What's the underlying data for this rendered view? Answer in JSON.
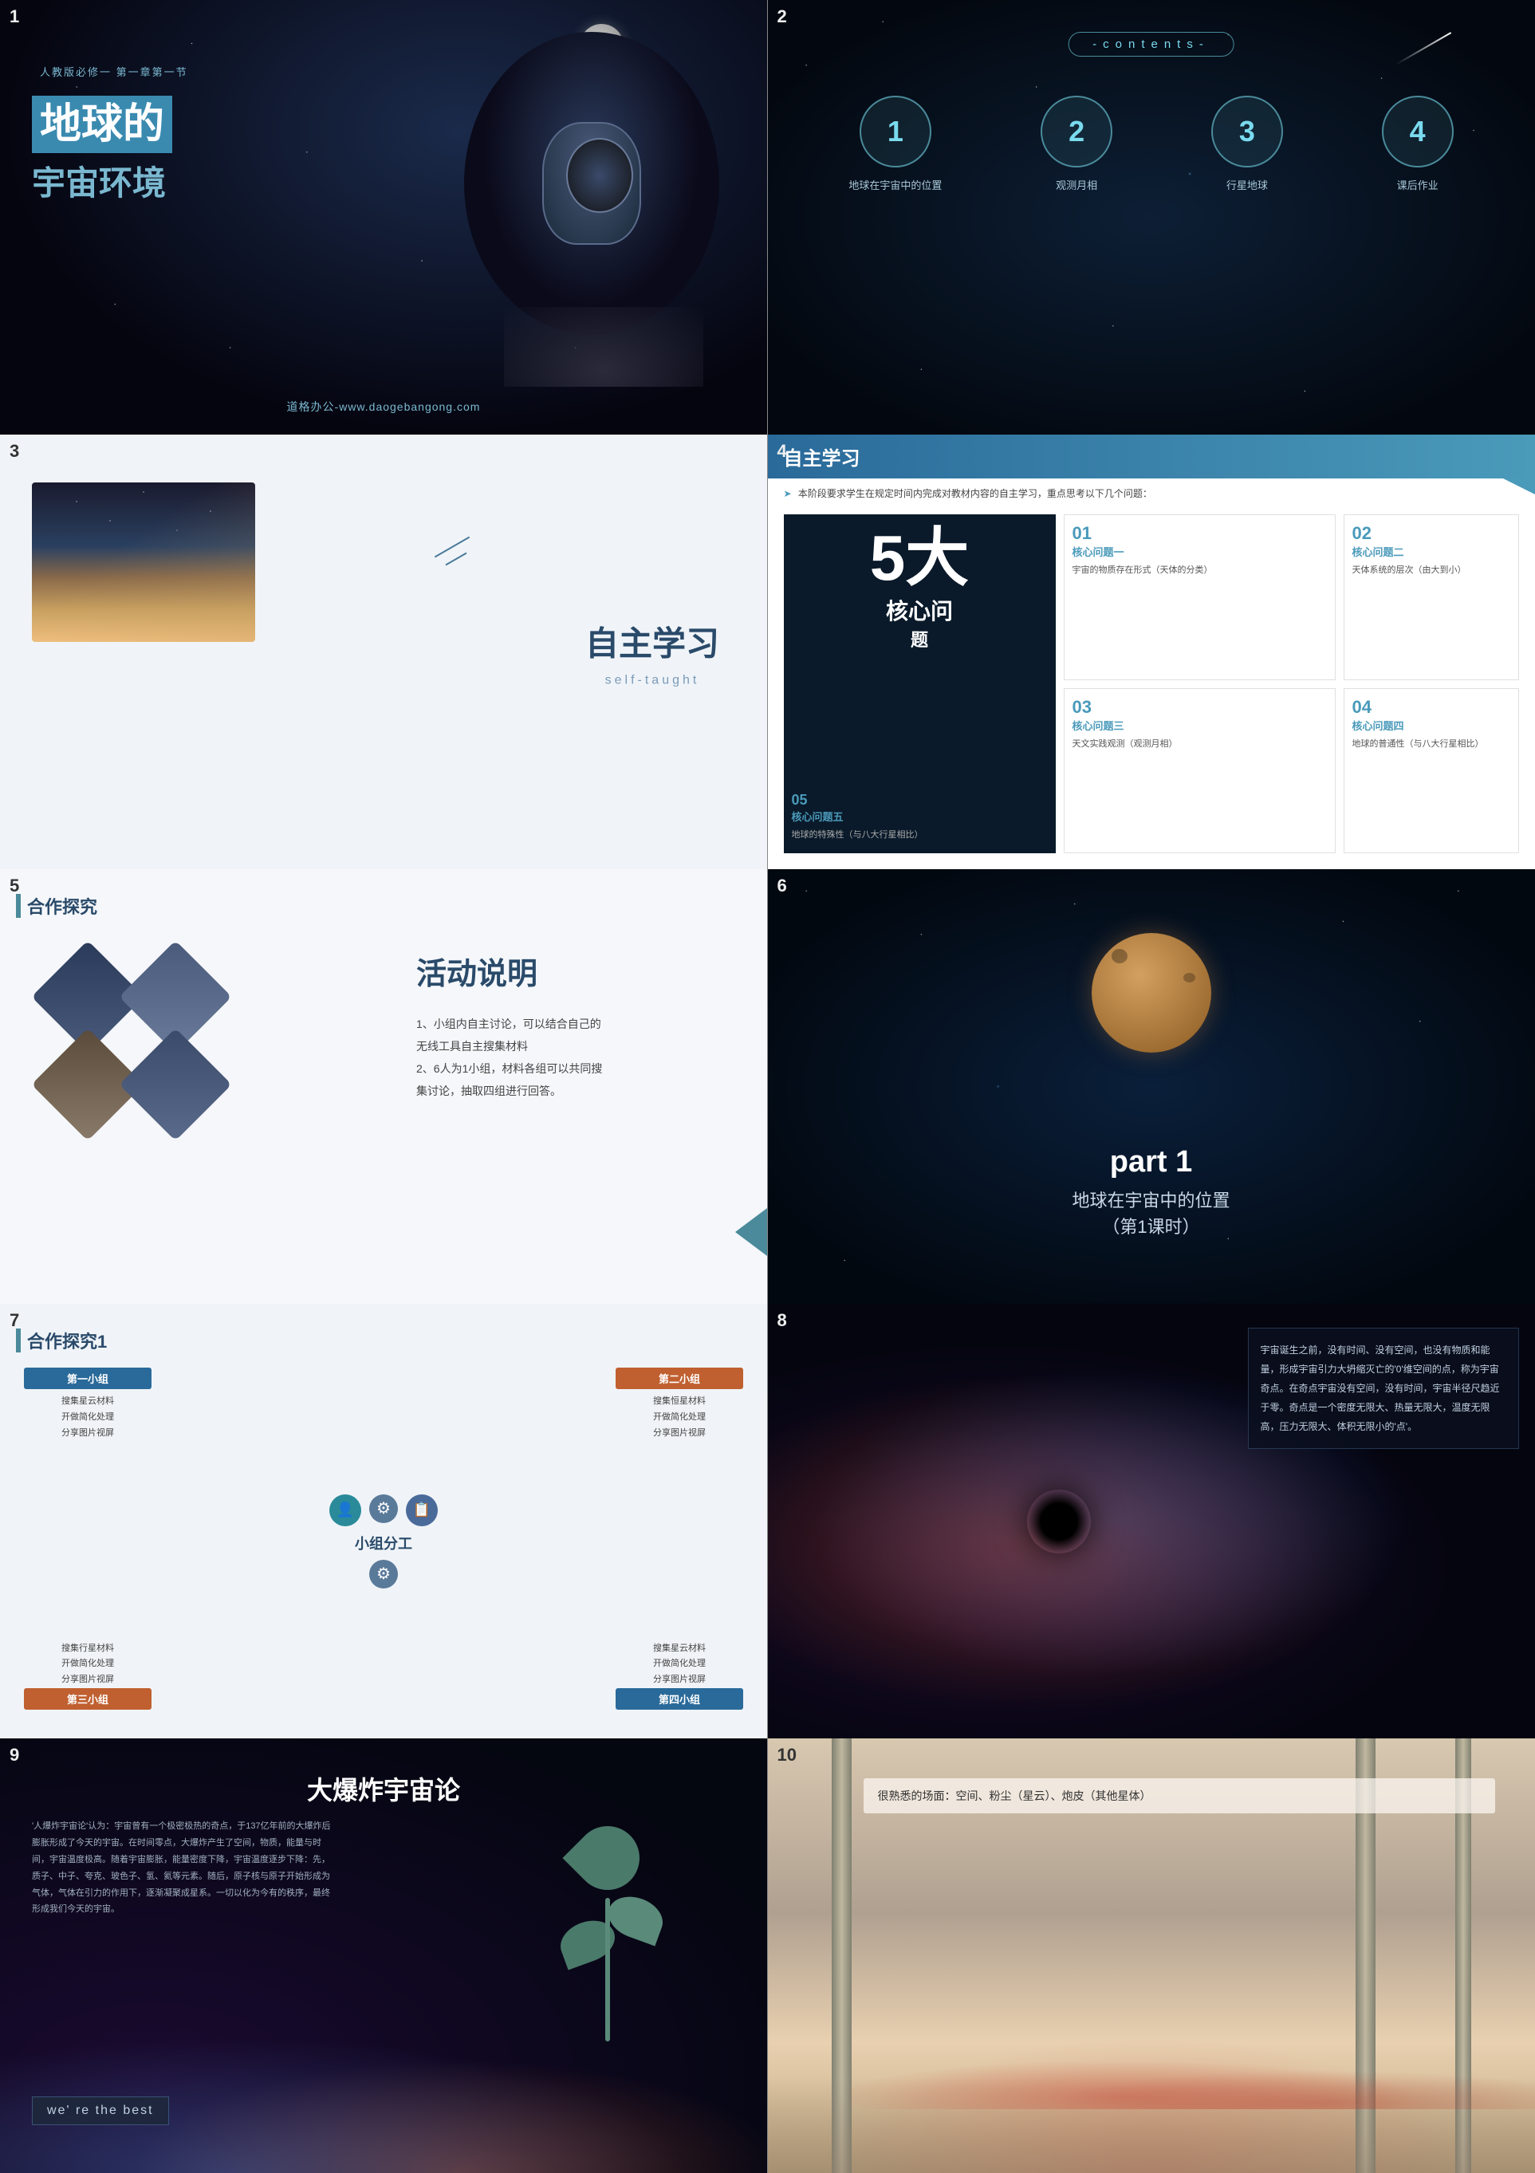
{
  "slide1": {
    "number": "1",
    "subtitle": "人教版必修一 第一章第一节",
    "title_main": "地球的",
    "title_sub": "宇宙环境",
    "footer": "道格办公-www.daogebangong.com"
  },
  "slide2": {
    "number": "2",
    "contents_label": "-contents-",
    "circles": [
      {
        "number": "1",
        "label": "地球在宇宙中的位置"
      },
      {
        "number": "2",
        "label": "观测月相"
      },
      {
        "number": "3",
        "label": "行星地球"
      },
      {
        "number": "4",
        "label": "课后作业"
      }
    ]
  },
  "slide3": {
    "number": "3",
    "main_title": "自主学习",
    "sub_title": "self-taught"
  },
  "slide4": {
    "number": "4",
    "header_title": "自主学习",
    "intro": "本阶段要求学生在规定时间内完成对教材内容的自主学习，重点思考以下几个问题：",
    "items": [
      {
        "num": "01",
        "title": "核心问题一",
        "text": "宇宙的物质存在形式（天体的分类）"
      },
      {
        "num": "02",
        "title": "核心问题二",
        "text": "天体系统的层次（由大到小）"
      },
      {
        "num": "03",
        "title": "核心问题三",
        "text": "天文实践观测（观测月相）"
      },
      {
        "num": "04",
        "title": "核心问题四",
        "text": "地球的普通性（与八大行星相比）"
      }
    ],
    "special_num": "5大",
    "special_text": "核心问",
    "special_sub": "题",
    "special_item_num": "05",
    "special_item_title": "核心问题五",
    "special_item_text": "地球的特殊性（与八大行星相比）"
  },
  "slide5": {
    "number": "5",
    "header_title": "合作探究",
    "activity_title": "活动说明",
    "activity_text1": "1、小组内自主讨论，可以结合自己的\n无线工具自主搜集材料",
    "activity_text2": "2、6人为1小组，材料各组可以共同搜\n集讨论，抽取四组进行回答。"
  },
  "slide6": {
    "number": "6",
    "part": "part 1",
    "subtitle1": "地球在宇宙中的位置",
    "subtitle2": "（第1课时）"
  },
  "slide7": {
    "number": "7",
    "header_title": "合作探究1",
    "center_title": "小组分工",
    "groups": [
      {
        "title": "第一小组",
        "color": "blue",
        "tasks": [
          "搜集星云材料",
          "开做简化处理",
          "分享图片视屏"
        ]
      },
      {
        "title": "第二小组",
        "color": "orange",
        "tasks": [
          "搜集恒星材料",
          "开做简化处理",
          "分享图片视屏"
        ]
      },
      {
        "title": "第三小组",
        "color": "orange",
        "tasks": [
          "搜集行星材料",
          "开做简化处理",
          "分享图片视屏"
        ]
      },
      {
        "title": "第四小组",
        "color": "blue",
        "tasks": [
          "搜集星云材料",
          "开做简化处理",
          "分享图片视屏"
        ]
      }
    ]
  },
  "slide8": {
    "number": "8",
    "text": "宇宙诞生之前，没有时间、没有空间，也没有物质和能量，形成宇宙引力大坍缩灭亡的'0'维空间的点，称为宇宙奇点。在奇点宇宙没有空间，没有时间，宇宙半径尺趋近于零。奇点是一个密度无限大、热量无限大，温度无限高，压力无限大、体积无限小的'点'。"
  },
  "slide9": {
    "number": "9",
    "title": "大爆炸宇宙论",
    "text": "'人爆炸宇宙论'认为：宇宙曾有一个极密极热的奇点，于137亿年前的大爆炸后膨胀形成了今天的宇宙。在时间零点，大爆炸产生了空间，物质，能量与时间，宇宙温度极高。随着宇宙膨胀，能量密度下降，宇宙温度逐步下降：先，质子、中子、夸克、玻色子、氢、氦等元素。随后，原子核与原子开始形成为气体，气体在引力的作用下，逐渐凝聚成星系。一切以化为今有的秩序，最终形成我们今天的宇宙。",
    "badge": "we' re the best"
  },
  "slide10": {
    "number": "10",
    "text": "很熟悉的场面：空间、粉尘（星云）、炮皮（其他星体）"
  }
}
